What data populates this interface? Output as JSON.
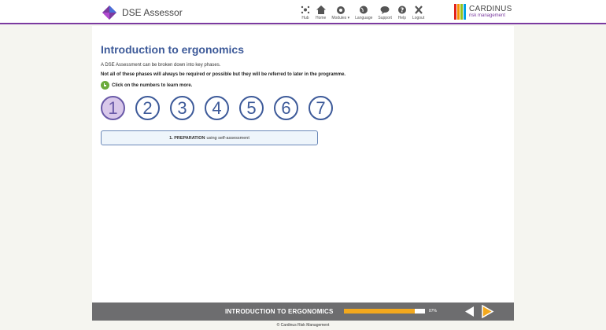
{
  "app": {
    "title": "DSE Assessor"
  },
  "nav": [
    {
      "label": "Hub",
      "icon": "hub-icon"
    },
    {
      "label": "Home",
      "icon": "home-icon"
    },
    {
      "label": "Modules ▾",
      "icon": "modules-icon"
    },
    {
      "label": "Language",
      "icon": "globe-icon"
    },
    {
      "label": "Support",
      "icon": "chat-icon"
    },
    {
      "label": "Help",
      "icon": "help-icon"
    },
    {
      "label": "Logout",
      "icon": "close-icon"
    }
  ],
  "brand": {
    "name": "CARDINUS",
    "sub": "risk management",
    "colors": [
      "#e2231a",
      "#f39200",
      "#95c11f",
      "#00a0e3",
      "#7b3aa0"
    ]
  },
  "page": {
    "title": "Introduction to ergonomics",
    "intro": "A DSE Assessment can be broken down into key phases.",
    "note": "Not all of these phases will always be required or possible but they will be referred to later in the programme.",
    "hint": "Click on the numbers to learn more."
  },
  "phases": [
    "1",
    "2",
    "3",
    "4",
    "5",
    "6",
    "7"
  ],
  "active_phase": {
    "title": "1. PREPARATION",
    "desc": "using self-assessment"
  },
  "footer": {
    "section": "INTRODUCTION TO ERGONOMICS",
    "progress_pct": 87,
    "progress_label": "87%",
    "copyright": "© Cardinus Risk Management"
  },
  "colors": {
    "accent": "#7b3aa0",
    "heading": "#3d5a99",
    "progress": "#f2a81d"
  }
}
